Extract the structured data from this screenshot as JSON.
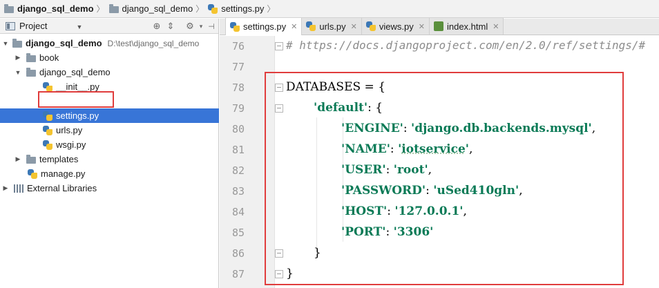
{
  "breadcrumb": {
    "items": [
      {
        "label": "django_sql_demo",
        "icon": "folder-icon",
        "bold": true
      },
      {
        "label": "django_sql_demo",
        "icon": "folder-icon",
        "bold": false
      },
      {
        "label": "settings.py",
        "icon": "python-file-icon",
        "bold": false
      }
    ]
  },
  "project_panel": {
    "title": "Project",
    "tree": [
      {
        "label": "django_sql_demo",
        "path": "D:\\test\\django_sql_demo",
        "depth": 0,
        "expanded": true,
        "icon": "folder-icon",
        "bold": true
      },
      {
        "label": "book",
        "depth": 1,
        "expanded": false,
        "icon": "folder-icon"
      },
      {
        "label": "django_sql_demo",
        "depth": 1,
        "expanded": true,
        "icon": "folder-icon"
      },
      {
        "label": "__init__.py",
        "depth": 2,
        "icon": "python-file-icon"
      },
      {
        "label": "settings.py",
        "depth": 2,
        "icon": "python-file-icon",
        "selected": true
      },
      {
        "label": "urls.py",
        "depth": 2,
        "icon": "python-file-icon"
      },
      {
        "label": "wsgi.py",
        "depth": 2,
        "icon": "python-file-icon"
      },
      {
        "label": "templates",
        "depth": 1,
        "expanded": false,
        "icon": "folder-icon"
      },
      {
        "label": "manage.py",
        "depth": 1,
        "icon": "python-file-icon"
      },
      {
        "label": "External Libraries",
        "depth": 0,
        "expanded": false,
        "icon": "library-icon"
      }
    ]
  },
  "tabs": [
    {
      "label": "settings.py",
      "icon": "python-file-icon",
      "active": true
    },
    {
      "label": "urls.py",
      "icon": "python-file-icon",
      "active": false
    },
    {
      "label": "views.py",
      "icon": "python-file-icon",
      "active": false
    },
    {
      "label": "index.html",
      "icon": "html-file-icon",
      "active": false
    }
  ],
  "editor": {
    "line_numbers": [
      "76",
      "77",
      "78",
      "79",
      "80",
      "81",
      "82",
      "83",
      "84",
      "85",
      "86",
      "87"
    ],
    "lines": {
      "l76": "# https://docs.djangoproject.com/en/2.0/ref/settings/#",
      "l78_name": "DATABASES",
      "l78_rest": " = {",
      "l79_key": "'default'",
      "l79_rest": ": {",
      "l80_key": "'ENGINE'",
      "l80_val": "'django.db.backends.mysql'",
      "l81_key": "'NAME'",
      "l81_val_q1": "'",
      "l81_val": "iotservice",
      "l81_val_q2": "'",
      "l82_key": "'USER'",
      "l82_val": "'root'",
      "l83_key": "'PASSWORD'",
      "l83_val": "'uSed410gln'",
      "l84_key": "'HOST'",
      "l84_val": "'127.0.0.1'",
      "l85_key": "'PORT'",
      "l85_val": "'3306'",
      "l86": "}",
      "l87": "}",
      "colon": ": ",
      "comma": ","
    }
  },
  "colors": {
    "accent_selection": "#3875d7",
    "annotation_red": "#e03c3c",
    "string_green": "#0a7a56"
  }
}
